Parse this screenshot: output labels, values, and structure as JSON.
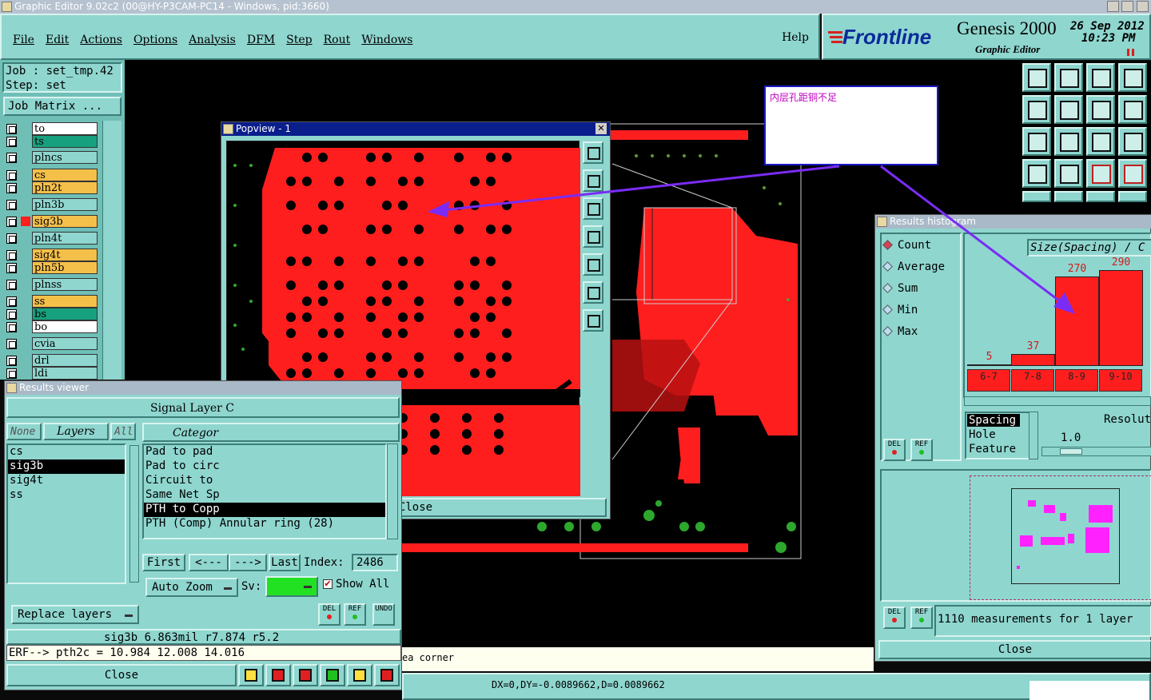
{
  "window": {
    "title": "Graphic Editor 9.02c2 (00@HY-P3CAM-PC14 - Windows, pid:3660)"
  },
  "menu": {
    "items": [
      "File",
      "Edit",
      "Actions",
      "Options",
      "Analysis",
      "DFM",
      "Step",
      "Rout",
      "Windows"
    ],
    "help": "Help"
  },
  "brand": {
    "logo": "Frontline",
    "product": "Genesis 2000",
    "subtitle": "Graphic Editor",
    "date": "26 Sep 2012",
    "time": "10:23 PM"
  },
  "job": {
    "job_label": "Job  : set_tmp.42",
    "step_label": "Step: set",
    "matrix_button": "Job Matrix ..."
  },
  "layers": [
    {
      "name": "to",
      "color": "#ffffff"
    },
    {
      "name": "ts",
      "color": "#17a07e"
    },
    {
      "name": "plncs",
      "color": "#8fd6cf"
    },
    {
      "name": "cs",
      "color": "#f5c04a"
    },
    {
      "name": "pln2t",
      "color": "#f5c04a"
    },
    {
      "name": "pln3b",
      "color": "#8fd6cf"
    },
    {
      "name": "sig3b",
      "color": "#f5c04a"
    },
    {
      "name": "pln4t",
      "color": "#8fd6cf"
    },
    {
      "name": "sig4t",
      "color": "#f5c04a"
    },
    {
      "name": "pln5b",
      "color": "#f5c04a"
    },
    {
      "name": "plnss",
      "color": "#8fd6cf"
    },
    {
      "name": "ss",
      "color": "#f5c04a"
    },
    {
      "name": "bs",
      "color": "#17a07e"
    },
    {
      "name": "bo",
      "color": "#ffffff"
    },
    {
      "name": "cvia",
      "color": "#8fd6cf"
    },
    {
      "name": "drl",
      "color": "#8fd6cf"
    },
    {
      "name": "ldi",
      "color": "#8fd6cf"
    }
  ],
  "annotation": {
    "note": "内层孔距铜不足"
  },
  "popview": {
    "title": "Popview - 1",
    "close": "Close"
  },
  "results_viewer": {
    "title": "Results viewer",
    "header": "Signal Layer C",
    "filter_none": "None",
    "filter_layers": "Layers",
    "filter_all": "All",
    "layer_list": [
      "cs",
      "sig3b",
      "sig4t",
      "ss"
    ],
    "category_header": "Categor",
    "categories": [
      "Pad to pad",
      "Pad to circ",
      "Circuit to",
      "Same Net Sp",
      "PTH to Copp",
      "PTH (Comp) Annular ring (28)"
    ],
    "nav_first": "First",
    "nav_prev": "<---",
    "nav_next": "--->",
    "nav_last": "Last",
    "index_label": "Index:",
    "index_value": "2486",
    "auto_zoom": "Auto Zoom",
    "sv_label": "Sv:",
    "show_all": "Show All",
    "replace_layers": "Replace layers",
    "measure_line": "sig3b  6.863mil   r7.874   r5.2",
    "erf_line": "ERF--> pth2c = 10.984 12.008 14.016",
    "close": "Close",
    "btn_del": "DEL",
    "btn_ref": "REF",
    "btn_undo": "UNDO"
  },
  "histogram": {
    "title": "Results histogram",
    "modes": [
      "Count",
      "Average",
      "Sum",
      "Min",
      "Max"
    ],
    "header": "Size(Spacing) / C",
    "types": [
      "Spacing",
      "Hole",
      "Feature"
    ],
    "resolution_label": "Resolut",
    "resolution_value": "1.0",
    "measurements": "1110 measurements for 1 layer",
    "close": "Close",
    "btn_del": "DEL",
    "btn_ref": "REF"
  },
  "chart_data": {
    "type": "bar",
    "categories": [
      "6-7",
      "7-8",
      "8-9",
      "9-10"
    ],
    "values": [
      5,
      37,
      270,
      290
    ],
    "title": "Size(Spacing) / C",
    "xlabel": "",
    "ylabel": ""
  },
  "status": {
    "message": "ea corner",
    "coords": "DX=0,DY=-0.0089662,D=0.0089662"
  }
}
